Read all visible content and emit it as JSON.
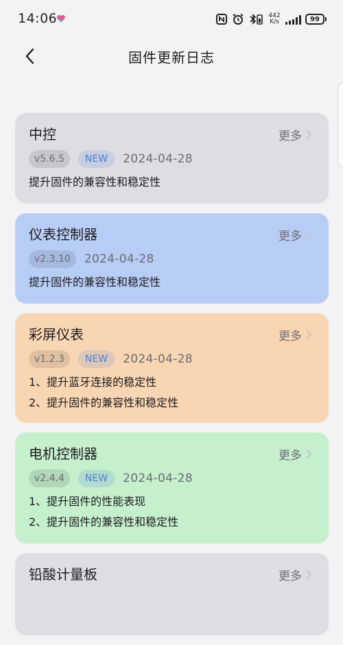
{
  "status_bar": {
    "time": "14:06",
    "net_speed_value": "442",
    "net_speed_unit": "K/s",
    "battery": "99"
  },
  "header": {
    "title": "固件更新日志"
  },
  "cards": [
    {
      "title": "中控",
      "more_label": "更多",
      "version": "v5.6.5",
      "new_label": "NEW",
      "date": "2024-04-28",
      "notes": [
        "提升固件的兼容性和稳定性"
      ],
      "color": "#dedee2"
    },
    {
      "title": "仪表控制器",
      "more_label": "更多",
      "version": "v2.3.10",
      "date": "2024-04-28",
      "notes": [
        "提升固件的兼容性和稳定性"
      ],
      "color": "#b8cdf6"
    },
    {
      "title": "彩屏仪表",
      "more_label": "更多",
      "version": "v1.2.3",
      "new_label": "NEW",
      "date": "2024-04-28",
      "notes": [
        "1、提升蓝牙连接的稳定性",
        "2、提升固件的兼容性和稳定性"
      ],
      "color": "#f9d6b3"
    },
    {
      "title": "电机控制器",
      "more_label": "更多",
      "version": "v2.4.4",
      "new_label": "NEW",
      "date": "2024-04-28",
      "notes": [
        "1、提升固件的性能表现",
        "2、提升固件的兼容性和稳定性"
      ],
      "color": "#c6efce"
    },
    {
      "title": "铅酸计量板",
      "more_label": "更多",
      "color": "#dedee2"
    }
  ],
  "icons": {
    "back": "chevron-left-icon",
    "more": "chevron-right-icon",
    "nfc": "nfc-icon",
    "alarm": "alarm-icon",
    "bluetooth": "bluetooth-battery-icon",
    "signal": "signal-icon",
    "battery": "battery-icon",
    "heart": "heart-icon"
  },
  "colors": {
    "background": "#f3f3f5",
    "new_tag": "#4a7fd4",
    "heart": "#e0608a"
  }
}
